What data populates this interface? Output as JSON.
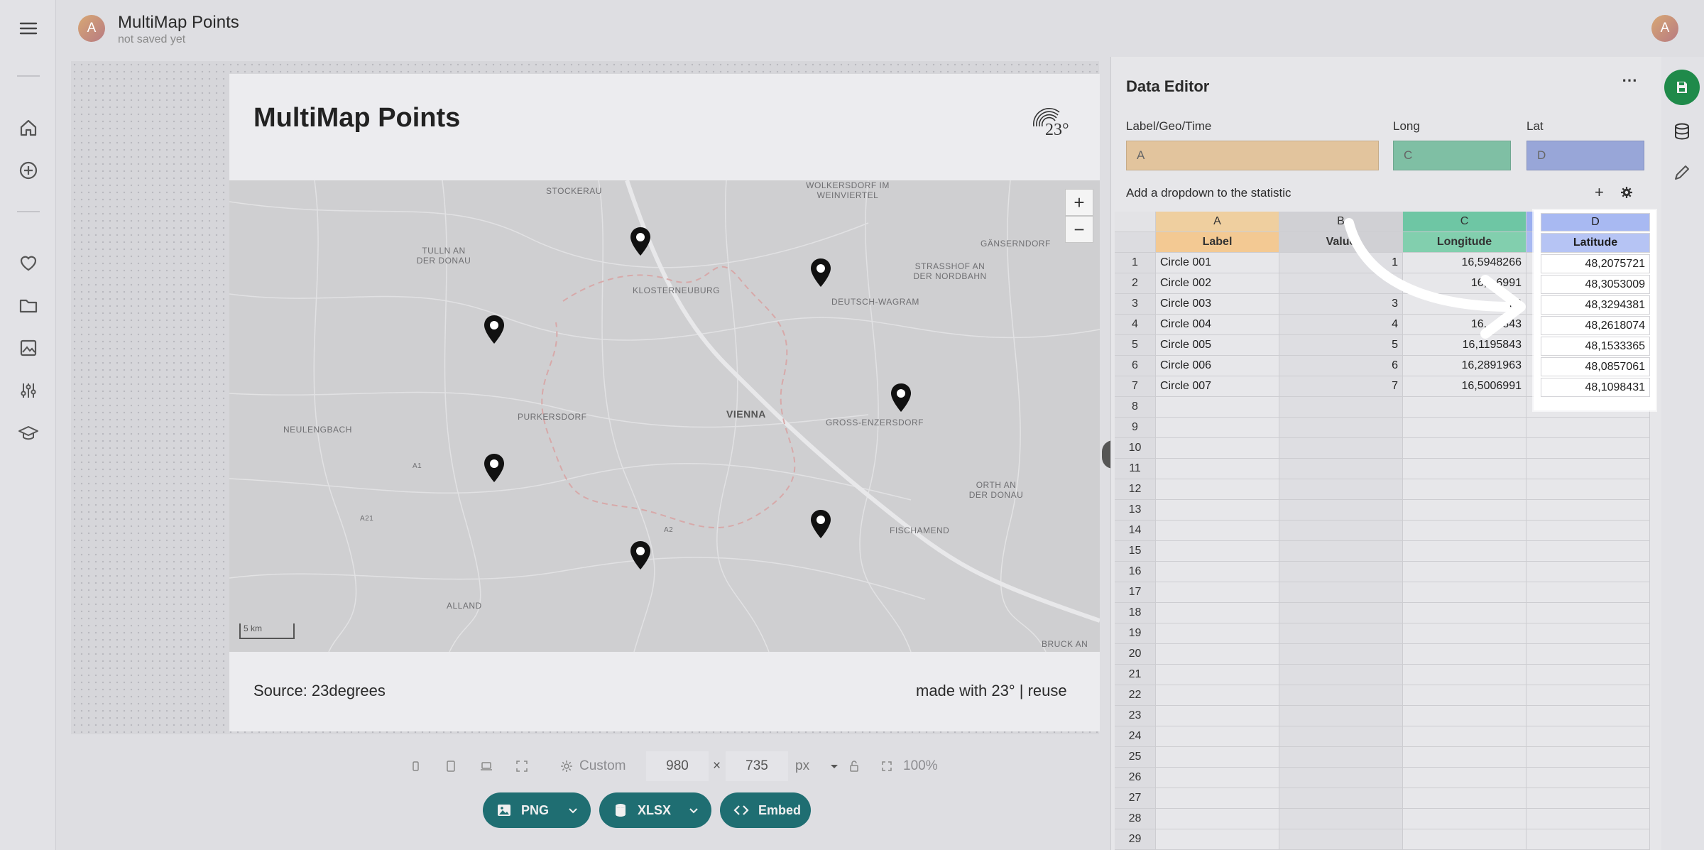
{
  "app": {
    "avatar_initial": "A",
    "doc_title": "MultiMap Points",
    "doc_status": "not saved yet"
  },
  "left_nav": {
    "items": [
      "menu-icon",
      "home-icon",
      "add-icon",
      "heart-icon",
      "folder-icon",
      "image-icon",
      "sliders-icon",
      "graduation-cap-icon"
    ]
  },
  "chart": {
    "title": "MultiMap Points",
    "logo_text": "23°",
    "source": "Source: 23degrees",
    "made_with": "made with 23° | reuse"
  },
  "map": {
    "labels": [
      "STOCKERAU",
      "WOLKERSDORF IM WEINVIERTEL",
      "GÄNSERNDORF",
      "TULLN AN DER DONAU",
      "KLOSTERNEUBURG",
      "STRASSHOF AN DER NORDBAHN",
      "DEUTSCH-WAGRAM",
      "NEULENGBACH",
      "PURKERSDORF",
      "VIENNA",
      "GROSS-ENZERSDORF",
      "ORTH AN DER DONAU",
      "FISCHAMEND",
      "ALLAND",
      "BRUCK AN",
      "A1",
      "A21",
      "A2"
    ],
    "zoom_in": "+",
    "zoom_out": "−",
    "scale": "5 km"
  },
  "toolbar": {
    "size_preset": "Custom",
    "width": "980",
    "x": "×",
    "height": "735",
    "unit": "px",
    "zoom": "100%"
  },
  "export": {
    "png": "PNG",
    "xlsx": "XLSX",
    "embed": "Embed"
  },
  "editor": {
    "title": "Data Editor",
    "more": "⋯",
    "mapping": {
      "label_title": "Label/Geo/Time",
      "label_value": "A",
      "long_title": "Long",
      "long_value": "C",
      "lat_title": "Lat",
      "lat_value": "D"
    },
    "dropdown_text": "Add a dropdown to the statistic",
    "add": "+"
  },
  "grid": {
    "col_letters": [
      "A",
      "B",
      "C",
      "D"
    ],
    "col_headers": [
      "Label",
      "Value",
      "Longitude",
      "Latitude"
    ],
    "rows": [
      [
        "Circle 001",
        "1",
        "16,5948266",
        "48,2075721"
      ],
      [
        "Circle 002",
        "",
        "16,...6991",
        "48,3053009"
      ],
      [
        "Circle 003",
        "3",
        "...3",
        "48,3294381"
      ],
      [
        "Circle 004",
        "4",
        "16,...5843",
        "48,2618074"
      ],
      [
        "Circle 005",
        "5",
        "16,1195843",
        "48,1533365"
      ],
      [
        "Circle 006",
        "6",
        "16,2891963",
        "48,0857061"
      ],
      [
        "Circle 007",
        "7",
        "16,5006991",
        "48,1098431"
      ]
    ],
    "row_count": 29
  },
  "colors": {
    "label_col": "#f3c993",
    "long_col": "#6ec6a4",
    "lat_col": "#9aaef0",
    "accent": "#1f6e72",
    "save": "#1f8a4a"
  }
}
